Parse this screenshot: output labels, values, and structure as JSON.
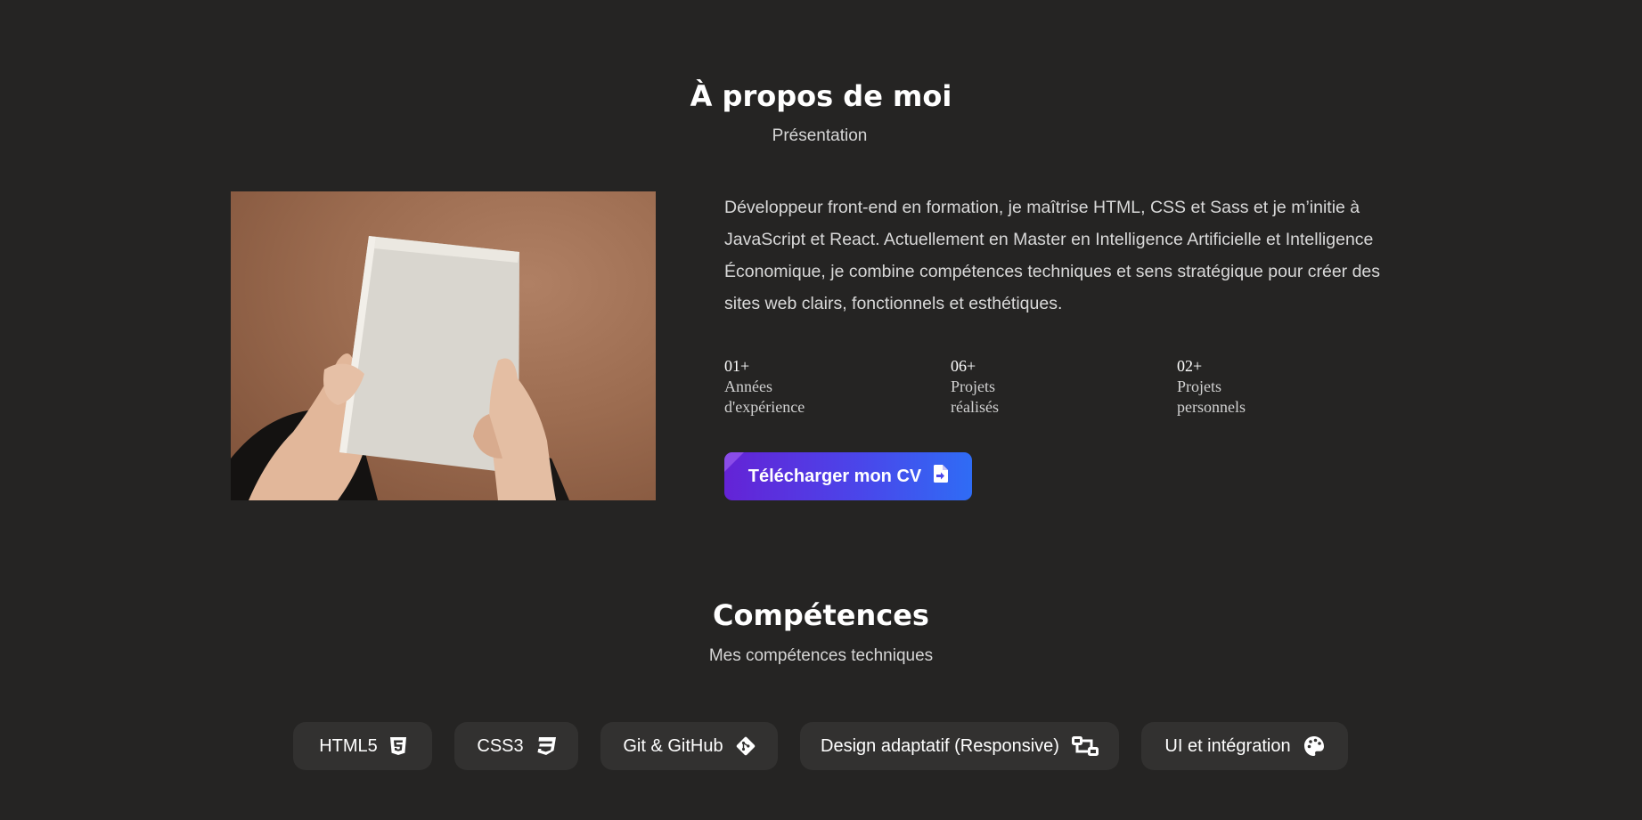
{
  "about": {
    "title": "À propos de moi",
    "subtitle": "Présentation",
    "bio": "Développeur front-end en formation, je maîtrise HTML, CSS et Sass et je m’initie à JavaScript et React. Actuellement en Master en Intelligence Artificielle et Intelligence Économique, je combine compétences techniques et sens stratégique pour créer des sites web clairs, fonctionnels et esthétiques.",
    "stats": [
      {
        "number": "01+",
        "label": "Années d'expérience"
      },
      {
        "number": "06+",
        "label": "Projets réalisés"
      },
      {
        "number": "02+",
        "label": "Projets personnels"
      }
    ],
    "cv_button": {
      "label": "Télécharger mon CV",
      "icon": "file-import-icon"
    }
  },
  "skills": {
    "title": "Compétences",
    "subtitle": "Mes compétences techniques",
    "items": [
      {
        "label": "HTML5",
        "icon": "html5-icon"
      },
      {
        "label": "CSS3",
        "icon": "css3-icon"
      },
      {
        "label": "Git & GitHub",
        "icon": "git-icon"
      },
      {
        "label": "Design adaptatif (Responsive)",
        "icon": "responsive-icon"
      },
      {
        "label": "UI et intégration",
        "icon": "palette-icon"
      }
    ]
  },
  "colors": {
    "background": "#252423",
    "chip": "#323130",
    "button_gradient_start": "#6423d6",
    "button_gradient_end": "#2f6cf5"
  }
}
